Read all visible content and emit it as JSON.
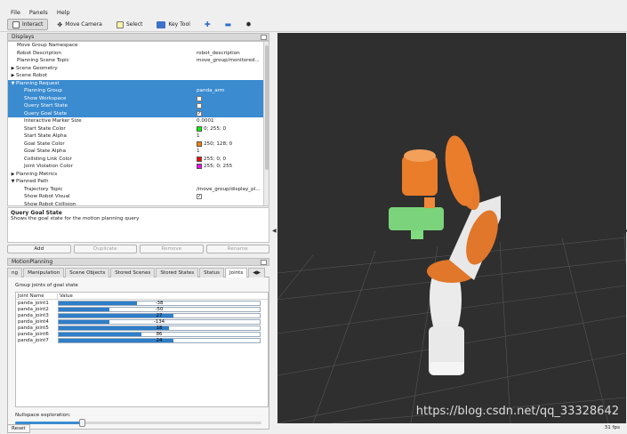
{
  "menubar": {
    "file": "File",
    "panels": "Panels",
    "help": "Help"
  },
  "toolbar": {
    "interact": "Interact",
    "move_camera": "Move Camera",
    "select": "Select",
    "key_tool": "Key Tool"
  },
  "displays": {
    "title": "Displays",
    "rows": [
      {
        "k": "Move Group Namespace",
        "v": "",
        "indent": 1
      },
      {
        "k": "Robot Description",
        "v": "robot_description",
        "indent": 1
      },
      {
        "k": "Planning Scene Topic",
        "v": "move_group/monitored...",
        "indent": 1
      },
      {
        "k": "Scene Geometry",
        "v": "",
        "indent": 0,
        "arrow": "▶"
      },
      {
        "k": "Scene Robot",
        "v": "",
        "indent": 0,
        "arrow": "▶"
      },
      {
        "k": "Planning Request",
        "v": "",
        "indent": 0,
        "arrow": "▼",
        "sel": true
      },
      {
        "k": "Planning Group",
        "v": "panda_arm",
        "indent": 2,
        "sel": true
      },
      {
        "k": "Show Workspace",
        "v": "",
        "indent": 2,
        "sel": true,
        "check": ""
      },
      {
        "k": "Query Start State",
        "v": "",
        "indent": 2,
        "sel": true,
        "check": ""
      },
      {
        "k": "Query Goal State",
        "v": "",
        "indent": 2,
        "sel": true,
        "check": "✓"
      },
      {
        "k": "Interactive Marker Size",
        "v": "0.0001",
        "indent": 2
      },
      {
        "k": "Start State Color",
        "v": "0; 255; 0",
        "indent": 2,
        "color": "#00ff00"
      },
      {
        "k": "Start State Alpha",
        "v": "1",
        "indent": 2
      },
      {
        "k": "Goal State Color",
        "v": "250; 128; 0",
        "indent": 2,
        "color": "#fa8000"
      },
      {
        "k": "Goal State Alpha",
        "v": "1",
        "indent": 2
      },
      {
        "k": "Colliding Link Color",
        "v": "255; 0; 0",
        "indent": 2,
        "color": "#ff0000"
      },
      {
        "k": "Joint Violation Color",
        "v": "255; 0; 255",
        "indent": 2,
        "color": "#ff00ff"
      },
      {
        "k": "Planning Metrics",
        "v": "",
        "indent": 0,
        "arrow": "▶"
      },
      {
        "k": "Planned Path",
        "v": "",
        "indent": 0,
        "arrow": "▼"
      },
      {
        "k": "Trajectory Topic",
        "v": "/move_group/display_pl...",
        "indent": 2
      },
      {
        "k": "Show Robot Visual",
        "v": "",
        "indent": 2,
        "check": "✓"
      },
      {
        "k": "Show Robot Collision",
        "v": "",
        "indent": 2
      }
    ]
  },
  "description": {
    "title": "Query Goal State",
    "text": "Shows the goal state for the motion planning query"
  },
  "buttons": {
    "add": "Add",
    "duplicate": "Duplicate",
    "remove": "Remove",
    "rename": "Rename"
  },
  "motion_planning": {
    "title": "MotionPlanning",
    "tabs": [
      "ng",
      "Manipulation",
      "Scene Objects",
      "Stored Scenes",
      "Stored States",
      "Status",
      "Joints"
    ],
    "active_tab": "Joints",
    "group_label": "Group joints of goal state",
    "columns": [
      "Joint Name",
      "Value"
    ],
    "joints": [
      {
        "name": "panda_joint1",
        "value": "-38",
        "frac": 0.39
      },
      {
        "name": "panda_joint2",
        "value": "-50",
        "frac": 0.25
      },
      {
        "name": "panda_joint3",
        "value": "27",
        "frac": 0.57
      },
      {
        "name": "panda_joint4",
        "value": "-134",
        "frac": 0.25
      },
      {
        "name": "panda_joint5",
        "value": "18",
        "frac": 0.55
      },
      {
        "name": "panda_joint6",
        "value": "86",
        "frac": 0.41
      },
      {
        "name": "panda_joint7",
        "value": "24",
        "frac": 0.57
      }
    ],
    "nullspace_label": "Nullspace exploration:",
    "nullspace_level": 0.27
  },
  "reset": "Reset",
  "fps": "31 fps",
  "watermark": "https://blog.csdn.net/qq_33328642"
}
